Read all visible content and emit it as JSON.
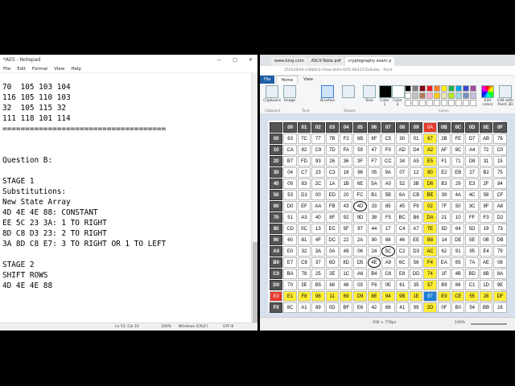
{
  "notepad": {
    "title": "*AES - Notepad",
    "controls": [
      "—",
      "□",
      "✕"
    ],
    "menu": [
      "File",
      "Edit",
      "Format",
      "View",
      "Help"
    ],
    "lines": [
      "70  105 103 104",
      "116 105 110 103",
      "32  105 115 32",
      "111 118 101 114",
      "====================================",
      "",
      "",
      "Question B:",
      "",
      "STAGE 1",
      "Substitutions:",
      "New State Array",
      "4D 4E 4E 88: CONSTANT",
      "EE 5C 23 3A: 1 TO RIGHT",
      "8D C8 D3 23: 2 TO RIGHT",
      "3A 8D C8 E7: 3 TO RIGHT OR 1 TO LEFT",
      "",
      "STAGE 2",
      "SHIFT ROWS",
      "4D 4E 4E 88"
    ],
    "status": {
      "position": "Ln 53, Col 22",
      "zoom": "100%",
      "line_ending": "Windows (CRLF)",
      "encoding": "UTF-8"
    }
  },
  "browser": {
    "tabs": [
      "www.bing.com",
      "ASCII-Table.pdf",
      "cryptography exam p"
    ],
    "address": "254526f49-a38b6c0-50aa-4b0e-82f1-8b3157bdeaba - Paint"
  },
  "paint": {
    "menu": {
      "file": "File",
      "home": "Home",
      "view": "View"
    },
    "ribbon": {
      "clipboard": "Clipboard",
      "image": "Image",
      "tools": "Tools",
      "brushes": "Brushes",
      "shapes": "Shapes",
      "size": "Size",
      "color1": "Color 1",
      "color2": "Color 2",
      "edit_colors": "Edit colors",
      "edit_paint3d": "Edit with Paint 3D",
      "colors_group": "Colors"
    },
    "palette": [
      "#000000",
      "#7f7f7f",
      "#880015",
      "#ed1c24",
      "#ff7f27",
      "#fff200",
      "#22b14c",
      "#00a2e8",
      "#3f48cc",
      "#a349a4",
      "#ffffff",
      "#c3c3c3",
      "#b97a57",
      "#ffaec9",
      "#ffc90e",
      "#efe4b0",
      "#b5e61d",
      "#99d9ea",
      "#7092be",
      "#c8bfe7",
      "#ffffff",
      "#ffffff",
      "#ffffff",
      "#ffffff",
      "#ffffff",
      "#ffffff",
      "#ffffff",
      "#ffffff",
      "#ffffff",
      "#ffffff"
    ],
    "status": {
      "dimensions": "936 × 778px",
      "zoom": "100%"
    }
  },
  "sbox": {
    "col_headers": [
      "00",
      "01",
      "02",
      "03",
      "04",
      "05",
      "06",
      "07",
      "08",
      "09",
      "0A",
      "0B",
      "0C",
      "0D",
      "0E",
      "0F"
    ],
    "row_headers": [
      "00",
      "10",
      "20",
      "30",
      "40",
      "50",
      "60",
      "70",
      "80",
      "90",
      "A0",
      "B0",
      "C0",
      "D0",
      "E0",
      "F0"
    ],
    "rows": [
      [
        "63",
        "7C",
        "77",
        "7B",
        "F2",
        "6B",
        "6F",
        "C5",
        "30",
        "01",
        "67",
        "2B",
        "FE",
        "D7",
        "AB",
        "76"
      ],
      [
        "CA",
        "82",
        "C9",
        "7D",
        "FA",
        "59",
        "47",
        "F0",
        "AD",
        "D4",
        "A2",
        "AF",
        "9C",
        "A4",
        "72",
        "C0"
      ],
      [
        "B7",
        "FD",
        "93",
        "26",
        "36",
        "3F",
        "F7",
        "CC",
        "34",
        "A5",
        "E5",
        "F1",
        "71",
        "D8",
        "31",
        "15"
      ],
      [
        "04",
        "C7",
        "23",
        "C3",
        "18",
        "96",
        "05",
        "9A",
        "07",
        "12",
        "80",
        "E2",
        "EB",
        "27",
        "B2",
        "75"
      ],
      [
        "09",
        "83",
        "2C",
        "1A",
        "1B",
        "6E",
        "5A",
        "A0",
        "52",
        "3B",
        "D6",
        "B3",
        "29",
        "E3",
        "2F",
        "84"
      ],
      [
        "53",
        "D1",
        "00",
        "ED",
        "20",
        "FC",
        "B1",
        "5B",
        "6A",
        "CB",
        "BE",
        "39",
        "4A",
        "4C",
        "58",
        "CF"
      ],
      [
        "D0",
        "EF",
        "AA",
        "FB",
        "43",
        "4D",
        "33",
        "85",
        "45",
        "F9",
        "02",
        "7F",
        "50",
        "3C",
        "9F",
        "A8"
      ],
      [
        "51",
        "A3",
        "40",
        "8F",
        "92",
        "9D",
        "38",
        "F5",
        "BC",
        "B6",
        "DA",
        "21",
        "10",
        "FF",
        "F3",
        "D2"
      ],
      [
        "CD",
        "0C",
        "13",
        "EC",
        "5F",
        "97",
        "44",
        "17",
        "C4",
        "A7",
        "7E",
        "3D",
        "64",
        "5D",
        "19",
        "73"
      ],
      [
        "60",
        "81",
        "4F",
        "DC",
        "22",
        "2A",
        "90",
        "88",
        "46",
        "EE",
        "B8",
        "14",
        "DE",
        "5E",
        "0B",
        "DB"
      ],
      [
        "E0",
        "32",
        "3A",
        "0A",
        "49",
        "06",
        "24",
        "5C",
        "C2",
        "D3",
        "AC",
        "62",
        "91",
        "95",
        "E4",
        "79"
      ],
      [
        "E7",
        "C8",
        "37",
        "6D",
        "8D",
        "D5",
        "4E",
        "A9",
        "6C",
        "56",
        "F4",
        "EA",
        "65",
        "7A",
        "AE",
        "08"
      ],
      [
        "BA",
        "78",
        "25",
        "2E",
        "1C",
        "A6",
        "B4",
        "C6",
        "E8",
        "DD",
        "74",
        "1F",
        "4B",
        "BD",
        "8B",
        "8A"
      ],
      [
        "70",
        "3E",
        "B5",
        "66",
        "48",
        "03",
        "F6",
        "0E",
        "61",
        "35",
        "57",
        "B9",
        "86",
        "C1",
        "1D",
        "9E"
      ],
      [
        "E1",
        "F8",
        "98",
        "11",
        "69",
        "D9",
        "8E",
        "94",
        "9B",
        "1E",
        "87",
        "E9",
        "CE",
        "55",
        "28",
        "DF"
      ],
      [
        "8C",
        "A1",
        "89",
        "0D",
        "BF",
        "E6",
        "42",
        "68",
        "41",
        "99",
        "2D",
        "0F",
        "B0",
        "54",
        "BB",
        "16"
      ]
    ]
  }
}
